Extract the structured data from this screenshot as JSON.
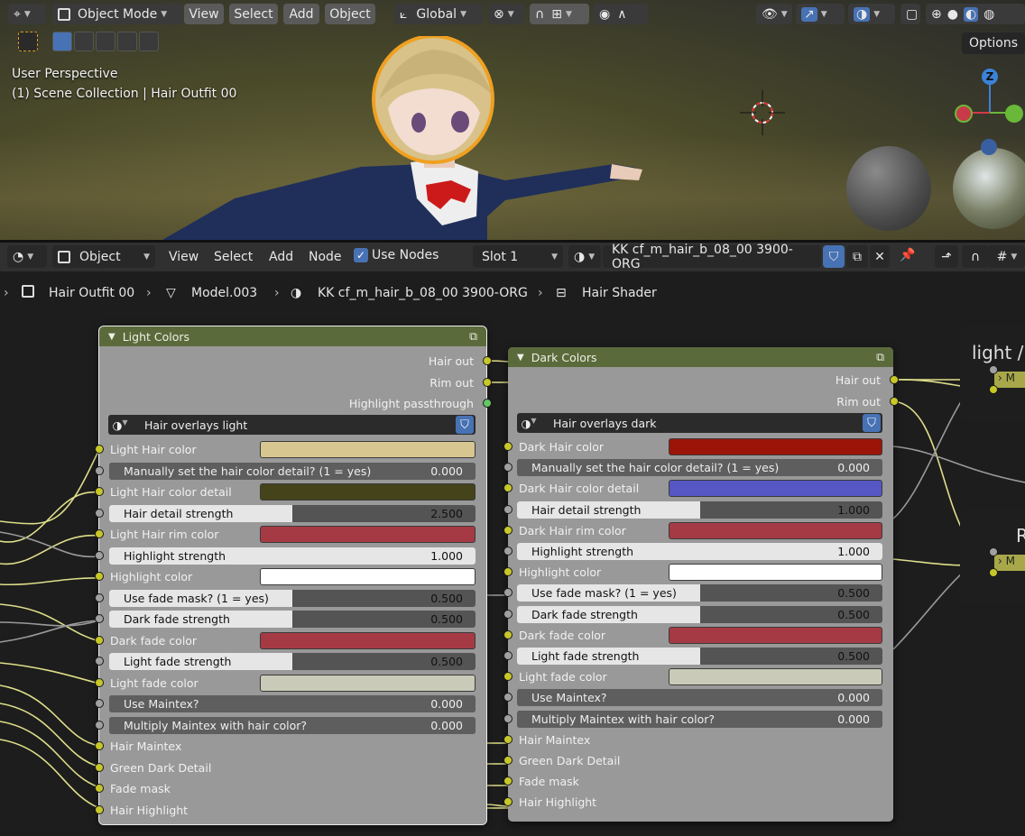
{
  "viewport": {
    "mode": "Object Mode",
    "menus": [
      "View",
      "Select",
      "Add",
      "Object"
    ],
    "transform": "Global",
    "overlay_text": [
      "User Perspective",
      "(1) Scene Collection | Hair Outfit 00"
    ],
    "options": "Options",
    "gizmo": {
      "z": "Z"
    }
  },
  "node_header": {
    "editor": "Object",
    "menus": [
      "View",
      "Select",
      "Add",
      "Node"
    ],
    "use_nodes": "Use Nodes",
    "slot": "Slot 1",
    "material": "KK cf_m_hair_b_08_00 3900-ORG"
  },
  "breadcrumb": [
    "Hair Outfit 00",
    "Model.003",
    "KK cf_m_hair_b_08_00 3900-ORG",
    "Hair Shader"
  ],
  "colors": {
    "node_header": "#5b6a3b",
    "node_body": "#999999",
    "socket_color": "#c7c729",
    "socket_float": "#a1a1a1",
    "socket_shader": "#63c763",
    "wire": "#dede8a",
    "accent": "#4772b3"
  },
  "light_node": {
    "title": "Light Colors",
    "outputs": [
      "Hair out",
      "Rim out",
      "Highlight passthrough"
    ],
    "group": "Hair overlays light",
    "inputs": [
      {
        "type": "color",
        "label": "Light Hair color",
        "color": "#d8c690"
      },
      {
        "type": "float",
        "label": "Manually set the hair color detail? (1 = yes)",
        "value": "0.000",
        "fill": 0
      },
      {
        "type": "color",
        "label": "Light Hair color detail",
        "color": "#45431a"
      },
      {
        "type": "float",
        "label": "Hair detail strength",
        "value": "2.500",
        "fill": 0.5
      },
      {
        "type": "color",
        "label": "Light Hair rim color",
        "color": "#a63a44"
      },
      {
        "type": "float",
        "label": "Highlight strength",
        "value": "1.000",
        "fill": 1
      },
      {
        "type": "color",
        "label": "Highlight color",
        "color": "#ffffff"
      },
      {
        "type": "float",
        "label": "Use fade mask? (1 = yes)",
        "value": "0.500",
        "fill": 0.5
      },
      {
        "type": "float",
        "label": "Dark fade strength",
        "value": "0.500",
        "fill": 0.5
      },
      {
        "type": "color",
        "label": "Dark fade color",
        "color": "#a63a44"
      },
      {
        "type": "float",
        "label": "Light fade strength",
        "value": "0.500",
        "fill": 0.5
      },
      {
        "type": "color",
        "label": "Light fade color",
        "color": "#cacab8"
      },
      {
        "type": "float",
        "label": "Use Maintex?",
        "value": "0.000",
        "fill": 0
      },
      {
        "type": "float",
        "label": "Multiply Maintex with hair color?",
        "value": "0.000",
        "fill": 0
      },
      {
        "type": "socket",
        "label": "Hair Maintex"
      },
      {
        "type": "socket",
        "label": "Green Dark Detail"
      },
      {
        "type": "socket",
        "label": "Fade mask"
      },
      {
        "type": "socket",
        "label": "Hair Highlight"
      }
    ]
  },
  "dark_node": {
    "title": "Dark Colors",
    "outputs": [
      "Hair out",
      "Rim out"
    ],
    "group": "Hair overlays dark",
    "inputs": [
      {
        "type": "color",
        "label": "Dark Hair color",
        "color": "#9c1408"
      },
      {
        "type": "float",
        "label": "Manually set the hair color detail? (1 = yes)",
        "value": "0.000",
        "fill": 0
      },
      {
        "type": "color",
        "label": "Dark Hair color detail",
        "color": "#5656c4"
      },
      {
        "type": "float",
        "label": "Hair detail strength",
        "value": "1.000",
        "fill": 0.5
      },
      {
        "type": "color",
        "label": "Dark Hair rim color",
        "color": "#a63a44"
      },
      {
        "type": "float",
        "label": "Highlight strength",
        "value": "1.000",
        "fill": 1
      },
      {
        "type": "color",
        "label": "Highlight color",
        "color": "#ffffff"
      },
      {
        "type": "float",
        "label": "Use fade mask? (1 = yes)",
        "value": "0.500",
        "fill": 0.5
      },
      {
        "type": "float",
        "label": "Dark fade strength",
        "value": "0.500",
        "fill": 0.5
      },
      {
        "type": "color",
        "label": "Dark fade color",
        "color": "#a63a44"
      },
      {
        "type": "float",
        "label": "Light fade strength",
        "value": "0.500",
        "fill": 0.5
      },
      {
        "type": "color",
        "label": "Light fade color",
        "color": "#cacab8"
      },
      {
        "type": "float",
        "label": "Use Maintex?",
        "value": "0.000",
        "fill": 0
      },
      {
        "type": "float",
        "label": "Multiply Maintex with hair color?",
        "value": "0.000",
        "fill": 0
      },
      {
        "type": "socket",
        "label": "Hair Maintex"
      },
      {
        "type": "socket",
        "label": "Green Dark Detail"
      },
      {
        "type": "socket",
        "label": "Fade mask"
      },
      {
        "type": "socket",
        "label": "Hair Highlight"
      }
    ]
  },
  "right_nodes": [
    {
      "title": "light /",
      "mini": "M"
    },
    {
      "title": "R",
      "mini": "M"
    }
  ]
}
